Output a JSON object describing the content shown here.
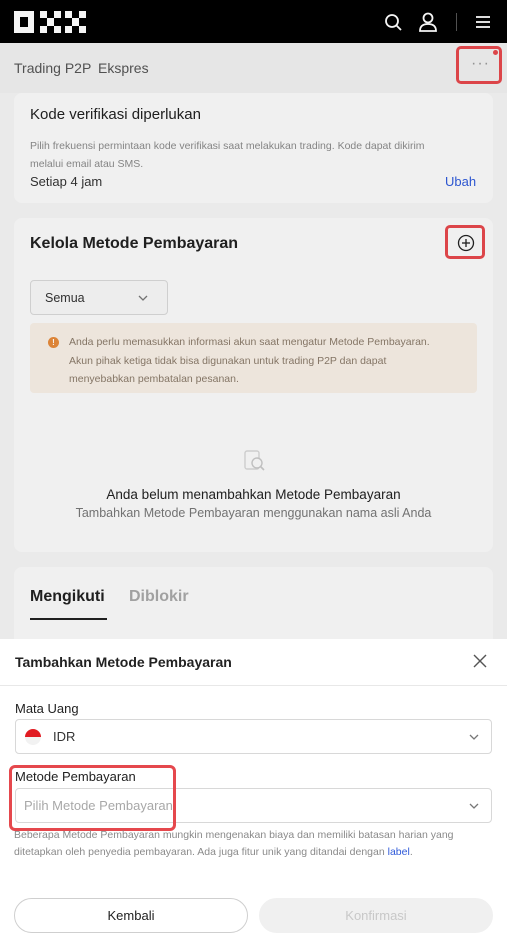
{
  "brand": {
    "logo_name": "OKX",
    "highlight_color": "#e5484d",
    "link_color": "#2f5ad9"
  },
  "topbar": {
    "icons": [
      "search-icon",
      "user-icon",
      "menu-icon"
    ]
  },
  "subnav": {
    "tab1": "Trading P2P",
    "tab2": "Ekspres",
    "more": "···"
  },
  "verification": {
    "title": "Kode verifikasi diperlukan",
    "description_line1": "Pilih frekuensi permintaan kode verifikasi saat melakukan trading. Kode dapat dikirim",
    "description_line2": "melalui email atau SMS.",
    "frequency": "Setiap 4 jam",
    "edit_label": "Ubah"
  },
  "payment_methods": {
    "title": "Kelola Metode Pembayaran",
    "filter_value": "Semua",
    "warning_line1": "Anda perlu memasukkan informasi akun saat mengatur Metode Pembayaran.",
    "warning_line2": "Akun pihak ketiga tidak bisa digunakan untuk trading P2P dan dapat",
    "warning_line3": "menyebabkan pembatalan pesanan.",
    "empty_title": "Anda belum menambahkan Metode Pembayaran",
    "empty_subtitle": "Tambahkan Metode Pembayaran menggunakan nama asli Anda"
  },
  "tabs": {
    "following": "Mengikuti",
    "blocked": "Diblokir"
  },
  "modal": {
    "title": "Tambahkan Metode Pembayaran",
    "currency_label": "Mata Uang",
    "currency_value": "IDR",
    "method_label": "Metode Pembayaran",
    "method_placeholder": "Pilih Metode Pembayaran",
    "note_text": "Beberapa Metode Pembayaran mungkin mengenakan biaya dan memiliki batasan harian yang ditetapkan oleh penyedia pembayaran. Ada juga fitur unik yang ditandai dengan",
    "note_link": "label",
    "back_label": "Kembali",
    "confirm_label": "Konfirmasi"
  }
}
